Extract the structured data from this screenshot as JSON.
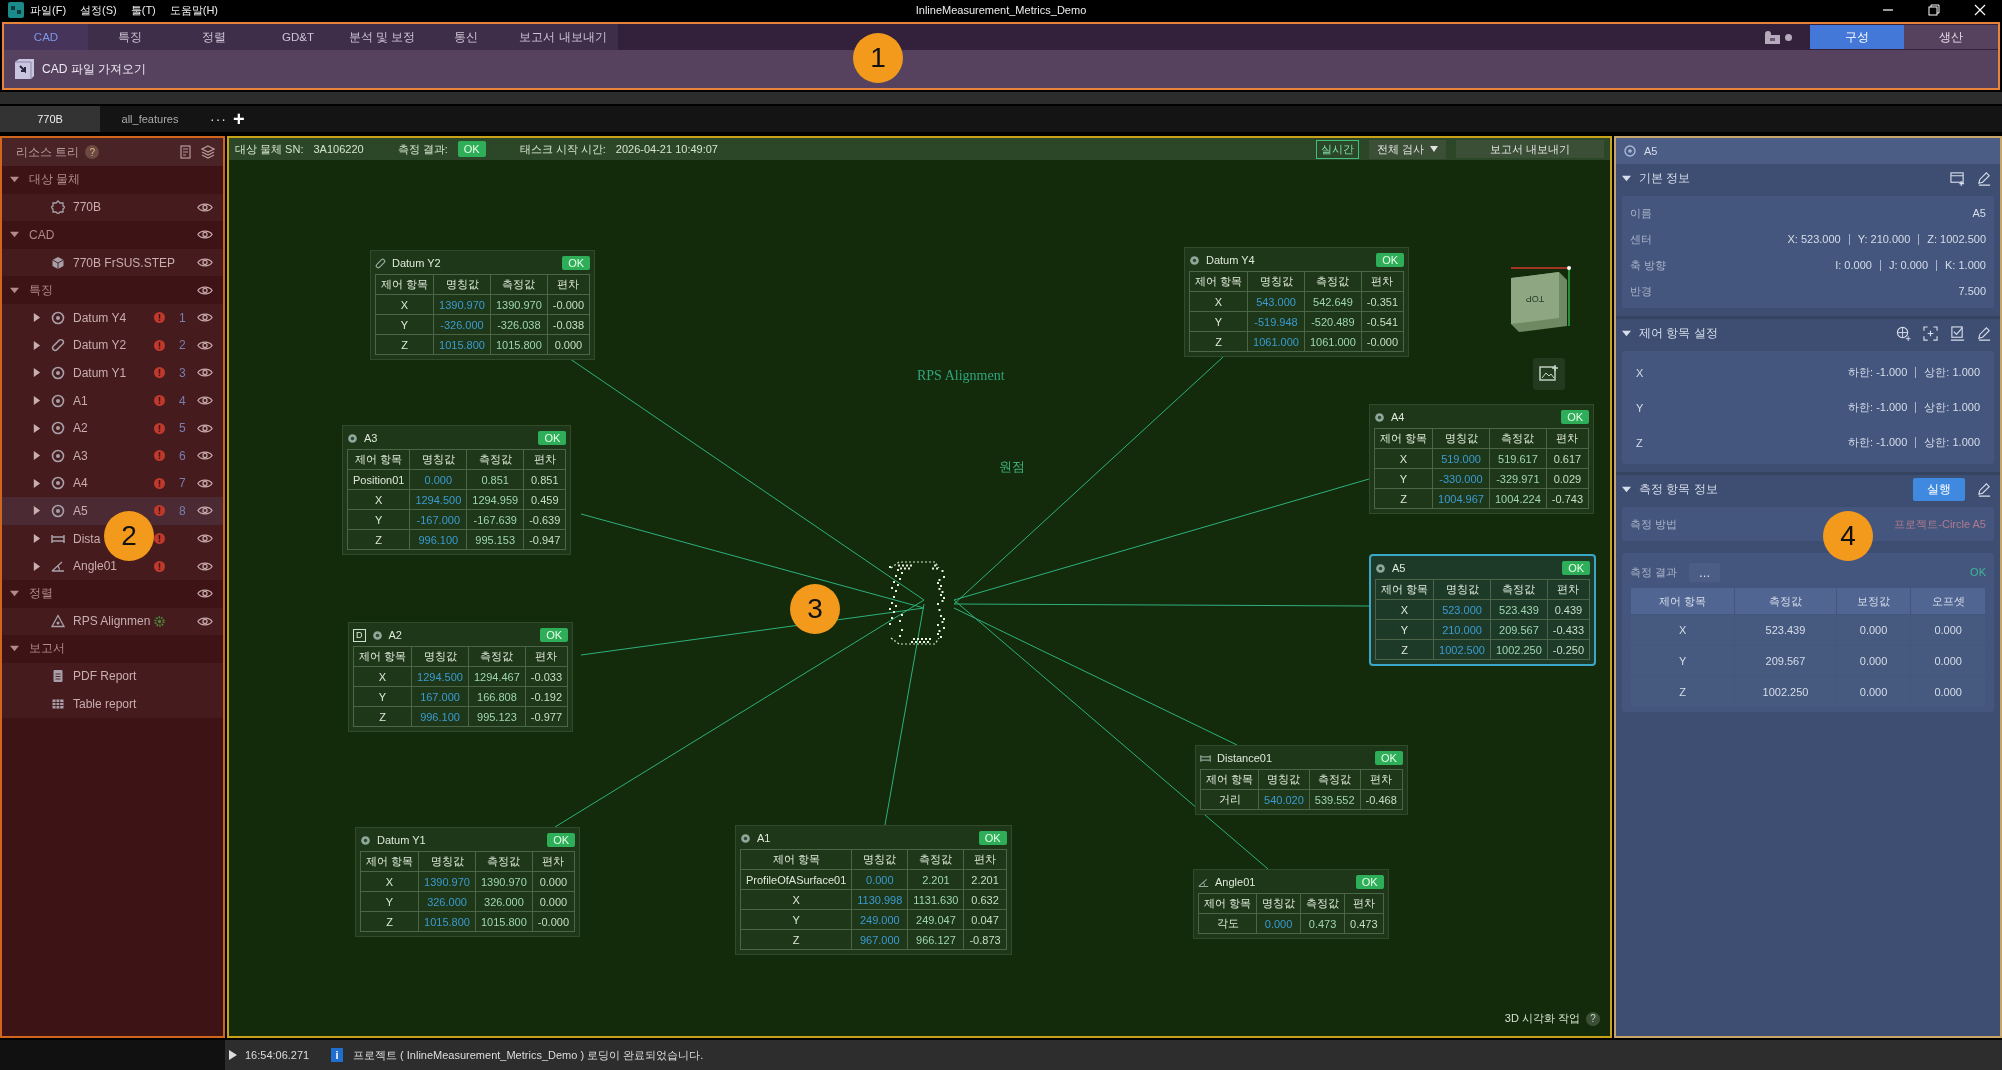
{
  "title_bar": {
    "menus": [
      "파일(F)",
      "설정(S)",
      "툴(T)",
      "도움말(H)"
    ],
    "title": "InlineMeasurement_Metrics_Demo"
  },
  "ribbon": {
    "tabs": [
      {
        "label": "CAD",
        "selected": true
      },
      {
        "label": "특징",
        "selected": false
      },
      {
        "label": "정렬",
        "selected": false
      },
      {
        "label": "GD&T",
        "selected": false
      },
      {
        "label": "분석 및 보정",
        "selected": false
      },
      {
        "label": "통신",
        "selected": false
      },
      {
        "label": "보고서 내보내기",
        "selected": false
      }
    ],
    "modes": [
      {
        "label": "구성",
        "selected": true
      },
      {
        "label": "생산",
        "selected": false
      }
    ],
    "tools": [
      {
        "label": "CAD 파일 가져오기"
      }
    ]
  },
  "doc_tabs": {
    "tabs": [
      {
        "label": "770B",
        "selected": true
      },
      {
        "label": "all_features",
        "selected": false
      }
    ],
    "more": "···",
    "add": "+"
  },
  "resource_tree": {
    "title": "리소스 트리",
    "help": "?",
    "sections": [
      {
        "label": "대상 물체",
        "expanded": true,
        "eye": false,
        "children": [
          {
            "name": "770B",
            "kind": "part",
            "expandable": false,
            "eye": true,
            "selected": false
          }
        ]
      },
      {
        "label": "CAD",
        "expanded": true,
        "eye": true,
        "children": [
          {
            "name": "770B FrSUS.STEP",
            "kind": "solid",
            "expandable": false,
            "eye": true,
            "selected": false
          }
        ]
      },
      {
        "label": "특징",
        "expanded": true,
        "eye": true,
        "children": [
          {
            "name": "Datum Y4",
            "kind": "circle",
            "expandable": true,
            "warning": true,
            "number": "1",
            "eye": true,
            "selected": false
          },
          {
            "name": "Datum Y2",
            "kind": "slot",
            "expandable": true,
            "warning": true,
            "number": "2",
            "eye": true,
            "selected": false
          },
          {
            "name": "Datum Y1",
            "kind": "circle",
            "expandable": true,
            "warning": true,
            "number": "3",
            "eye": true,
            "selected": false
          },
          {
            "name": "A1",
            "kind": "circle",
            "expandable": true,
            "warning": true,
            "number": "4",
            "eye": true,
            "selected": false
          },
          {
            "name": "A2",
            "kind": "circle",
            "expandable": true,
            "warning": true,
            "number": "5",
            "eye": true,
            "selected": false
          },
          {
            "name": "A3",
            "kind": "circle",
            "expandable": true,
            "warning": true,
            "number": "6",
            "eye": true,
            "selected": false
          },
          {
            "name": "A4",
            "kind": "circle",
            "expandable": true,
            "warning": true,
            "number": "7",
            "eye": true,
            "selected": false
          },
          {
            "name": "A5",
            "kind": "circle",
            "expandable": true,
            "warning": true,
            "number": "8",
            "eye": true,
            "selected": true
          },
          {
            "name": "Dista",
            "kind": "distance",
            "expandable": true,
            "warning": true,
            "eye": true,
            "selected": false
          },
          {
            "name": "Angle01",
            "kind": "angle",
            "expandable": true,
            "warning": true,
            "eye": true,
            "selected": false
          }
        ]
      },
      {
        "label": "정렬",
        "expanded": true,
        "eye": true,
        "children": [
          {
            "name": "RPS Alignmen",
            "kind": "alignment",
            "expandable": false,
            "synced": true,
            "eye": true,
            "selected": false
          }
        ]
      },
      {
        "label": "보고서",
        "expanded": true,
        "eye": false,
        "children": [
          {
            "name": "PDF Report",
            "kind": "pdf",
            "expandable": false,
            "eye": false,
            "selected": false
          },
          {
            "name": "Table report",
            "kind": "table",
            "expandable": false,
            "eye": false,
            "selected": false
          }
        ]
      }
    ]
  },
  "canvas": {
    "sn_label": "대상 물체 SN:",
    "sn": "3A106220",
    "result_label": "측정 결과:",
    "result": "OK",
    "start_label": "태스크 시작 시간:",
    "start": "2026-04-21 10:49:07",
    "realtime": "실시간",
    "inspect": "전체 검사",
    "export": "보고서 내보내기",
    "cube_label": "TOP",
    "labels": [
      "RPS Alignment",
      "원점"
    ],
    "footer": "3D 시각화 작업",
    "footer_help": "?",
    "cards": [
      {
        "name": "Datum Y2",
        "kind": "slot",
        "badge": "OK",
        "selected": false,
        "columns": [
          "제어 항목",
          "명칭값",
          "측정값",
          "편차"
        ],
        "rows": [
          [
            "X",
            "1390.970",
            "1390.970",
            "-0.000"
          ],
          [
            "Y",
            "-326.000",
            "-326.038",
            "-0.038"
          ],
          [
            "Z",
            "1015.800",
            "1015.800",
            "0.000"
          ]
        ]
      },
      {
        "name": "Datum Y4",
        "kind": "circle",
        "badge": "OK",
        "selected": false,
        "columns": [
          "제어 항목",
          "명칭값",
          "측정값",
          "편차"
        ],
        "rows": [
          [
            "X",
            "543.000",
            "542.649",
            "-0.351"
          ],
          [
            "Y",
            "-519.948",
            "-520.489",
            "-0.541"
          ],
          [
            "Z",
            "1061.000",
            "1061.000",
            "-0.000"
          ]
        ]
      },
      {
        "name": "A3",
        "kind": "circle",
        "badge": "OK",
        "selected": false,
        "columns": [
          "제어 항목",
          "명칭값",
          "측정값",
          "편차"
        ],
        "rows": [
          [
            "Position01",
            "0.000",
            "0.851",
            "0.851"
          ],
          [
            "X",
            "1294.500",
            "1294.959",
            "0.459"
          ],
          [
            "Y",
            "-167.000",
            "-167.639",
            "-0.639"
          ],
          [
            "Z",
            "996.100",
            "995.153",
            "-0.947"
          ]
        ]
      },
      {
        "name": "A4",
        "kind": "circle",
        "badge": "OK",
        "selected": false,
        "columns": [
          "제어 항목",
          "명칭값",
          "측정값",
          "편차"
        ],
        "rows": [
          [
            "X",
            "519.000",
            "519.617",
            "0.617"
          ],
          [
            "Y",
            "-330.000",
            "-329.971",
            "0.029"
          ],
          [
            "Z",
            "1004.967",
            "1004.224",
            "-0.743"
          ]
        ]
      },
      {
        "name": "A5",
        "kind": "circle",
        "badge": "OK",
        "selected": true,
        "columns": [
          "제어 항목",
          "명칭값",
          "측정값",
          "편차"
        ],
        "rows": [
          [
            "X",
            "523.000",
            "523.439",
            "0.439"
          ],
          [
            "Y",
            "210.000",
            "209.567",
            "-0.433"
          ],
          [
            "Z",
            "1002.500",
            "1002.250",
            "-0.250"
          ]
        ]
      },
      {
        "name": "A2",
        "kind": "circle",
        "datum": "D",
        "badge": "OK",
        "selected": false,
        "columns": [
          "제어 항목",
          "명칭값",
          "측정값",
          "편차"
        ],
        "rows": [
          [
            "X",
            "1294.500",
            "1294.467",
            "-0.033"
          ],
          [
            "Y",
            "167.000",
            "166.808",
            "-0.192"
          ],
          [
            "Z",
            "996.100",
            "995.123",
            "-0.977"
          ]
        ]
      },
      {
        "name": "Datum Y1",
        "kind": "circle",
        "badge": "OK",
        "selected": false,
        "columns": [
          "제어 항목",
          "명칭값",
          "측정값",
          "편차"
        ],
        "rows": [
          [
            "X",
            "1390.970",
            "1390.970",
            "0.000"
          ],
          [
            "Y",
            "326.000",
            "326.000",
            "0.000"
          ],
          [
            "Z",
            "1015.800",
            "1015.800",
            "-0.000"
          ]
        ]
      },
      {
        "name": "A1",
        "kind": "circle",
        "badge": "OK",
        "selected": false,
        "columns": [
          "제어 항목",
          "명칭값",
          "측정값",
          "편차"
        ],
        "rows": [
          [
            "ProfileOfASurface01",
            "0.000",
            "2.201",
            "2.201"
          ],
          [
            "X",
            "1130.998",
            "1131.630",
            "0.632"
          ],
          [
            "Y",
            "249.000",
            "249.047",
            "0.047"
          ],
          [
            "Z",
            "967.000",
            "966.127",
            "-0.873"
          ]
        ]
      },
      {
        "name": "Distance01",
        "kind": "distance",
        "badge": "OK",
        "selected": false,
        "columns": [
          "제어 항목",
          "명칭값",
          "측정값",
          "편차"
        ],
        "rows": [
          [
            "거리",
            "540.020",
            "539.552",
            "-0.468"
          ]
        ]
      },
      {
        "name": "Angle01",
        "kind": "angle",
        "badge": "OK",
        "selected": false,
        "columns": [
          "제어 항목",
          "명칭값",
          "측정값",
          "편차"
        ],
        "rows": [
          [
            "각도",
            "0.000",
            "0.473",
            "0.473"
          ]
        ]
      }
    ]
  },
  "properties": {
    "title": "A5",
    "basic_info": {
      "title": "기본 정보",
      "expanded": true,
      "rows": [
        {
          "label": "이름",
          "values": [
            "A5"
          ]
        },
        {
          "label": "센터",
          "values": [
            "X: 523.000",
            "Y: 210.000",
            "Z: 1002.500"
          ]
        },
        {
          "label": "축 방향",
          "values": [
            "I: 0.000",
            "J: 0.000",
            "K: 1.000"
          ]
        },
        {
          "label": "반경",
          "values": [
            "7.500"
          ]
        }
      ]
    },
    "control_settings": {
      "title": "제어 항목 설정",
      "expanded": true,
      "rows": [
        {
          "axis": "X",
          "lower": "하한: -1.000",
          "upper": "상한: 1.000"
        },
        {
          "axis": "Y",
          "lower": "하한: -1.000",
          "upper": "상한: 1.000"
        },
        {
          "axis": "Z",
          "lower": "하한: -1.000",
          "upper": "상한: 1.000"
        }
      ]
    },
    "measurement_info": {
      "title": "측정 항목 정보",
      "expanded": true,
      "run": "실행",
      "method_label": "측정 방법",
      "method": "프로젝트-Circle A5",
      "result_label": "측정 결과",
      "more": "...",
      "result": "OK",
      "columns": [
        "제어 항목",
        "측정값",
        "보정값",
        "오프셋"
      ],
      "rows": [
        [
          "X",
          "523.439",
          "0.000",
          "0.000"
        ],
        [
          "Y",
          "209.567",
          "0.000",
          "0.000"
        ],
        [
          "Z",
          "1002.250",
          "0.000",
          "0.000"
        ]
      ]
    }
  },
  "status_bar": {
    "time": "16:54:06.271",
    "info": "i",
    "message": "프로젝트 ( InlineMeasurement_Metrics_Demo ) 로딩이 완료되었습니다."
  },
  "callouts": [
    {
      "label": "1"
    },
    {
      "label": "2"
    },
    {
      "label": "3"
    },
    {
      "label": "4"
    }
  ]
}
